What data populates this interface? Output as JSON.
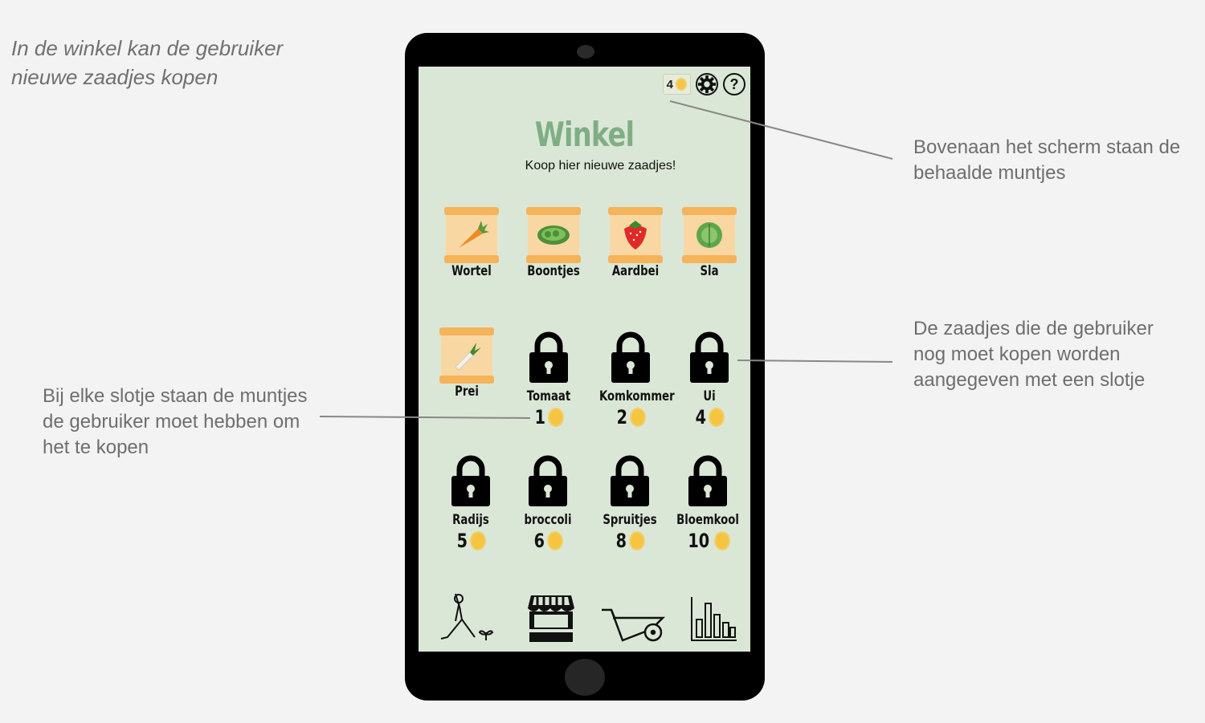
{
  "annotations": {
    "top_left": "In de winkel kan de gebruiker nieuwe zaadjes kopen",
    "right_top": "Bovenaan het scherm staan de behaalde muntjes",
    "right_middle": "De zaadjes die de gebruiker nog moet kopen worden aangegeven met een slotje",
    "left_middle": "Bij elke slotje staan de muntjes de gebruiker moet hebben om het te kopen"
  },
  "app": {
    "coins": "4",
    "help_icon": "?",
    "title": "Winkel",
    "subtitle": "Koop hier nieuwe zaadjes!"
  },
  "seeds": [
    {
      "name": "Wortel",
      "locked": false,
      "icon": "carrot"
    },
    {
      "name": "Boontjes",
      "locked": false,
      "icon": "beans"
    },
    {
      "name": "Aardbei",
      "locked": false,
      "icon": "strawberry"
    },
    {
      "name": "Sla",
      "locked": false,
      "icon": "lettuce"
    },
    {
      "name": "Prei",
      "locked": false,
      "icon": "leek"
    },
    {
      "name": "Tomaat",
      "locked": true,
      "price": "1"
    },
    {
      "name": "Komkommer",
      "locked": true,
      "price": "2"
    },
    {
      "name": "Ui",
      "locked": true,
      "price": "4"
    },
    {
      "name": "Radijs",
      "locked": true,
      "price": "5"
    },
    {
      "name": "broccoli",
      "locked": true,
      "price": "6"
    },
    {
      "name": "Spruitjes",
      "locked": true,
      "price": "8"
    },
    {
      "name": "Bloemkool",
      "locked": true,
      "price": "10"
    }
  ],
  "bottom_nav": [
    "exercise-icon",
    "shop-icon",
    "wheelbarrow-icon",
    "stats-icon"
  ],
  "colors": {
    "screen_bg": "#dbe7d6",
    "title": "#7fae85",
    "coin": "#f5c542",
    "pack": "#f9d7a3"
  }
}
